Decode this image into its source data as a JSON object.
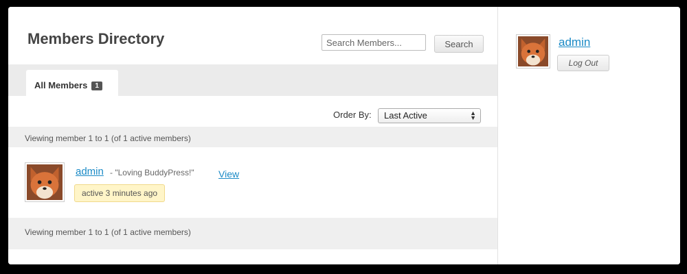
{
  "directory": {
    "title": "Members Directory",
    "search": {
      "placeholder": "Search Members...",
      "button_label": "Search"
    },
    "tabs": [
      {
        "label": "All Members",
        "count": "1"
      }
    ],
    "order_by": {
      "label": "Order By:",
      "selected": "Last Active"
    },
    "pagination_top": "Viewing member 1 to 1 (of 1 active members)",
    "pagination_bottom": "Viewing member 1 to 1 (of 1 active members)",
    "members": [
      {
        "name": "admin",
        "status": "- \"Loving BuddyPress!\"",
        "view_label": "View",
        "last_active": "active 3 minutes ago",
        "avatar_icon": "fox-avatar-icon"
      }
    ]
  },
  "sidebar": {
    "user_name": "admin",
    "logout_label": "Log Out",
    "avatar_icon": "fox-avatar-icon"
  },
  "colors": {
    "link": "#1a8ac6",
    "badge_bg": "#fff5c8",
    "tab_bar": "#ebebeb"
  }
}
